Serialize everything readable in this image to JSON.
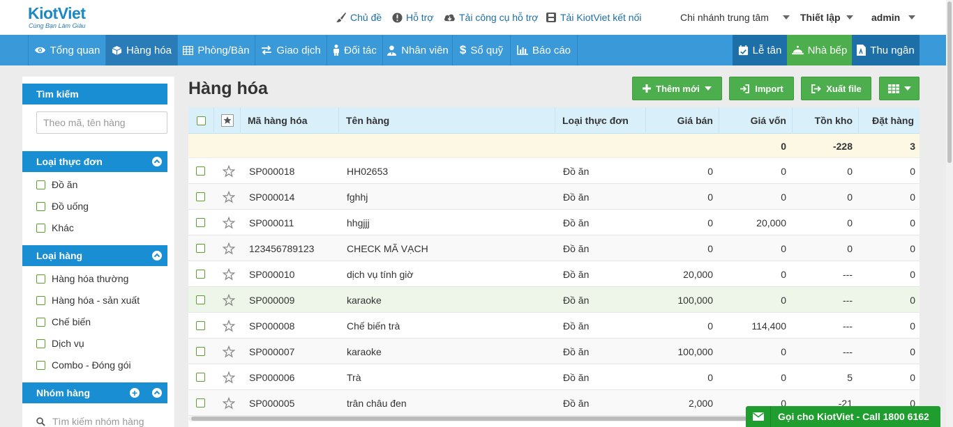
{
  "brand": {
    "name": "KiotViet",
    "slogan": "Cùng Bạn Làm Giàu"
  },
  "top_links": [
    "Chủ đề",
    "Hỗ trợ",
    "Tải công cụ hỗ trợ",
    "Tải KiotViet kết nối"
  ],
  "top_right": {
    "branch": "Chi nhánh trung tâm",
    "settings": "Thiết lập",
    "user": "admin"
  },
  "nav": [
    "Tổng quan",
    "Hàng hóa",
    "Phòng/Bàn",
    "Giao dịch",
    "Đối tác",
    "Nhân viên",
    "Sổ quỹ",
    "Báo cáo"
  ],
  "nav_right": [
    "Lễ tân",
    "Nhà bếp",
    "Thu ngân"
  ],
  "sidebar": {
    "search_title": "Tìm kiếm",
    "search_placeholder": "Theo mã, tên hàng",
    "menu_type_title": "Loại thực đơn",
    "menu_types": [
      "Đồ ăn",
      "Đồ uống",
      "Khác"
    ],
    "goods_type_title": "Loại hàng",
    "goods_types": [
      "Hàng hóa thường",
      "Hàng hóa - sản xuất",
      "Chế biến",
      "Dịch vụ",
      "Combo - Đóng gói"
    ],
    "group_title": "Nhóm hàng",
    "group_search": "Tìm kiếm nhóm hàng"
  },
  "page_title": "Hàng hóa",
  "buttons": {
    "add": "Thêm mới",
    "import": "Import",
    "export": "Xuất file"
  },
  "columns": [
    "Mã hàng hóa",
    "Tên hàng",
    "Loại thực đơn",
    "Giá bán",
    "Giá vốn",
    "Tồn kho",
    "Đặt hàng"
  ],
  "summary": {
    "cost": "0",
    "stock": "-228",
    "ordered": "3"
  },
  "rows": [
    {
      "code": "SP000018",
      "name": "HH02653",
      "menu": "Đồ ăn",
      "price": "0",
      "cost": "0",
      "stock": "0",
      "ordered": "0"
    },
    {
      "code": "SP000014",
      "name": "fghhj",
      "menu": "Đồ ăn",
      "price": "0",
      "cost": "0",
      "stock": "0",
      "ordered": "0"
    },
    {
      "code": "SP000011",
      "name": "hhgjjj",
      "menu": "Đồ ăn",
      "price": "0",
      "cost": "20,000",
      "stock": "0",
      "ordered": "0"
    },
    {
      "code": "123456789123",
      "name": "CHECK MÃ VẠCH",
      "menu": "Đồ ăn",
      "price": "0",
      "cost": "0",
      "stock": "0",
      "ordered": "0"
    },
    {
      "code": "SP000010",
      "name": "dịch vụ tính giờ",
      "menu": "Đồ ăn",
      "price": "20,000",
      "cost": "0",
      "stock": "---",
      "ordered": "0"
    },
    {
      "code": "SP000009",
      "name": "karaoke",
      "menu": "Đồ ăn",
      "price": "100,000",
      "cost": "0",
      "stock": "---",
      "ordered": "0"
    },
    {
      "code": "SP000008",
      "name": "Chế biến trà",
      "menu": "Đồ ăn",
      "price": "0",
      "cost": "114,400",
      "stock": "---",
      "ordered": "0"
    },
    {
      "code": "SP000007",
      "name": "karaoke",
      "menu": "Đồ ăn",
      "price": "100,000",
      "cost": "0",
      "stock": "---",
      "ordered": "0"
    },
    {
      "code": "SP000006",
      "name": "Trà",
      "menu": "Đồ ăn",
      "price": "0",
      "cost": "0",
      "stock": "5",
      "ordered": "0"
    },
    {
      "code": "SP000005",
      "name": "trân châu đen",
      "menu": "Đồ ăn",
      "price": "2,000",
      "cost": "0",
      "stock": "-21",
      "ordered": "0"
    }
  ],
  "callbar": "Gọi cho KiotViet - Call 1800 6162",
  "colors": {
    "nav": "#3a99d8",
    "nav_active": "#2a7cb8",
    "sidebar_head": "#1a8ed3",
    "button_green": "#4cae4c",
    "callbar": "#1f9d2f"
  }
}
